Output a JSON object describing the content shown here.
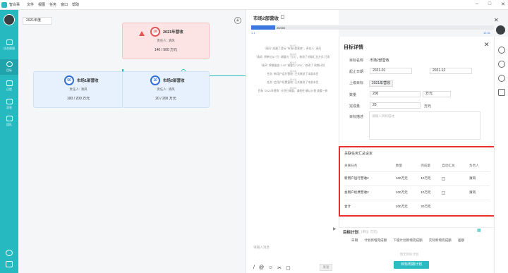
{
  "app": {
    "title": "智白事"
  },
  "menu": [
    "文件",
    "视图",
    "任务",
    "窗口",
    "帮助"
  ],
  "rail": {
    "items": [
      {
        "label": "任务视图"
      },
      {
        "label": "目标"
      },
      {
        "label": "日程"
      },
      {
        "label": "消息"
      },
      {
        "label": "团队"
      }
    ]
  },
  "canvas": {
    "year": "2021年度",
    "root": {
      "num": "28",
      "name": "2021年营收",
      "owner": "责任人: 清风",
      "amount": "140 / 500 万元"
    },
    "child1": {
      "num": "50",
      "name": "市场1部营收",
      "owner": "责任人: 清风",
      "amount": "100 / 200 万元"
    },
    "child2": {
      "num": "10",
      "name": "市场2部营收",
      "owner": "责任人: 清风",
      "amount": "20 / 200 万元"
    }
  },
  "chat": {
    "title": "市场2部营收",
    "progress": {
      "label": "20/200",
      "start": "1.1",
      "end": "12.31",
      "fraction": 0.1
    },
    "messages": [
      {
        "time": "16:43",
        "text": "\"清风\" 创建了目标 \"市场2部营收\"，责任人: 清风"
      },
      {
        "time": "16:43",
        "text": "\"清风\" 将单位从 \"元\" 调整为 \"万元\"，修改了关联汇总方式 已改"
      },
      {
        "time": "16:45",
        "text": "\"清风\" 将数量由 \"100\" 调整为 \"200\"，修改了 周期计划"
      },
      {
        "time": "16:46",
        "text": "任务 \"新用户运行营收\" 已关联进了本部本目"
      },
      {
        "time": "16:49",
        "text": "任务 \"会用户续费营收\" 已关联进了本部本目"
      },
      {
        "time": "16:53",
        "text": "目标 \"2021年营收\" 计划已调整，请前往 确认计划 查看一致"
      }
    ],
    "input_placeholder": "请输入消息",
    "send": "发送"
  },
  "detail": {
    "title": "目标详情",
    "fields": {
      "name_label": "目标名称",
      "name_value": "市场2部营收",
      "period_label": "起止日期",
      "start": "2021-01",
      "end": "2021-12",
      "parent_label": "上级目标",
      "parent_value": "2021年营收",
      "qty_label": "数量",
      "qty_value": "200",
      "unit": "万元",
      "done_label": "完成量",
      "done_value": "20",
      "done_unit": "万元",
      "desc_label": "目标描述",
      "desc_placeholder": "请输入目标描述"
    }
  },
  "linked": {
    "title": "关联任务汇总设定",
    "headers": [
      "关联任务",
      "数量",
      "完成量",
      "自动汇总",
      "负责人"
    ],
    "rows": [
      {
        "task": "新用户运行营收2",
        "qty": "100万元",
        "done": "10万元",
        "owner": "清风"
      },
      {
        "task": "会用户续费营收2",
        "qty": "100万元",
        "done": "10万元",
        "owner": "清风"
      }
    ],
    "total": {
      "label": "合计",
      "qty": "200万元",
      "done": "20万元"
    }
  },
  "plan": {
    "title": "目标计划",
    "sub": "(单位: 万元)",
    "cols": [
      "日期",
      "计划新增完成额",
      "下级计划新增完成额",
      "实际新增完成额",
      "差额"
    ],
    "empty": "暂无目标计划",
    "button": "目标周期计划"
  }
}
